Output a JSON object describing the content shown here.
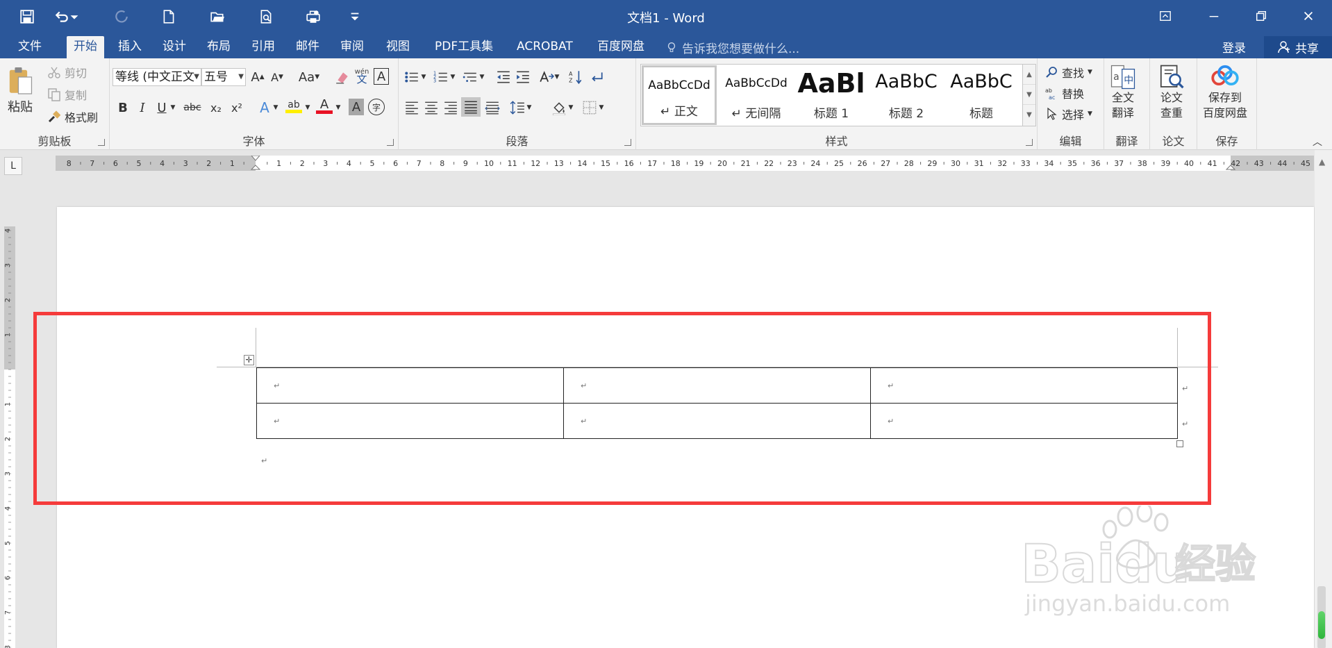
{
  "window": {
    "title": "文档1 - Word"
  },
  "menu": {
    "tabs": [
      "文件",
      "开始",
      "插入",
      "设计",
      "布局",
      "引用",
      "邮件",
      "审阅",
      "视图",
      "PDF工具集",
      "ACROBAT",
      "百度网盘"
    ],
    "active_index": 1,
    "tell_me": "告诉我您想要做什么...",
    "login": "登录",
    "share": "共享"
  },
  "ribbon": {
    "clipboard": {
      "label": "剪贴板",
      "paste": "粘贴",
      "cut": "剪切",
      "copy": "复制",
      "format_painter": "格式刷"
    },
    "font": {
      "label": "字体",
      "font_name": "等线 (中文正文",
      "font_size": "五号",
      "change_case": "Aa",
      "phonetic_top": "wén",
      "phonetic_bottom": "文",
      "border_char": "A",
      "bold": "B",
      "italic": "I",
      "underline": "U",
      "strike": "abc",
      "subscript": "x₂",
      "superscript": "x²",
      "effects": "A",
      "highlight": "ab",
      "font_color": "A",
      "shading_char": "A",
      "enclose_char": "字"
    },
    "paragraph": {
      "label": "段落"
    },
    "styles": {
      "label": "样式",
      "items": [
        {
          "sample": "AaBbCcDd",
          "name": "↵ 正文"
        },
        {
          "sample": "AaBbCcDd",
          "name": "↵ 无间隔"
        },
        {
          "sample": "AaBl",
          "name": "标题 1"
        },
        {
          "sample": "AaBbC",
          "name": "标题 2"
        },
        {
          "sample": "AaBbC",
          "name": "标题"
        }
      ]
    },
    "editing": {
      "label": "编辑",
      "find": "查找",
      "replace": "替换",
      "select": "选择"
    },
    "translate": {
      "label": "翻译",
      "button_line1": "全文",
      "button_line2": "翻译"
    },
    "paper": {
      "label": "论文",
      "button_line1": "论文",
      "button_line2": "查重"
    },
    "save": {
      "label": "保存",
      "button_line1": "保存到",
      "button_line2": "百度网盘"
    }
  },
  "ruler": {
    "corner": "L",
    "left_numbers": [
      "8",
      "7",
      "6",
      "5",
      "4",
      "3",
      "2",
      "1"
    ],
    "right_numbers": [
      "1",
      "2",
      "3",
      "4",
      "5",
      "6",
      "7",
      "8",
      "9",
      "10",
      "11",
      "12",
      "13",
      "14",
      "15",
      "16",
      "17",
      "18",
      "19",
      "20",
      "21",
      "22",
      "23",
      "24",
      "25",
      "26",
      "27",
      "28",
      "29",
      "30",
      "31",
      "32",
      "33",
      "34",
      "35",
      "36",
      "37",
      "38",
      "39",
      "40",
      "41",
      "42",
      "43",
      "44",
      "45"
    ],
    "vertical_numbers": [
      "4",
      "3",
      "2",
      "1",
      "1",
      "2",
      "3",
      "4",
      "5",
      "6",
      "7",
      "8"
    ]
  },
  "document": {
    "table": {
      "rows": [
        [
          "↵",
          "↵",
          "↵"
        ],
        [
          "↵",
          "↵",
          "↵"
        ]
      ],
      "row_end_marks": [
        "↵",
        "↵"
      ]
    },
    "after_table_mark": "↵"
  },
  "watermark": {
    "brand": "Baidu",
    "cn": "经验",
    "url": "jingyan.baidu.com"
  },
  "colors": {
    "title_bar": "#2b579a",
    "ribbon_bg": "#f3f3f3",
    "highlight_box": "#f53b3b"
  }
}
